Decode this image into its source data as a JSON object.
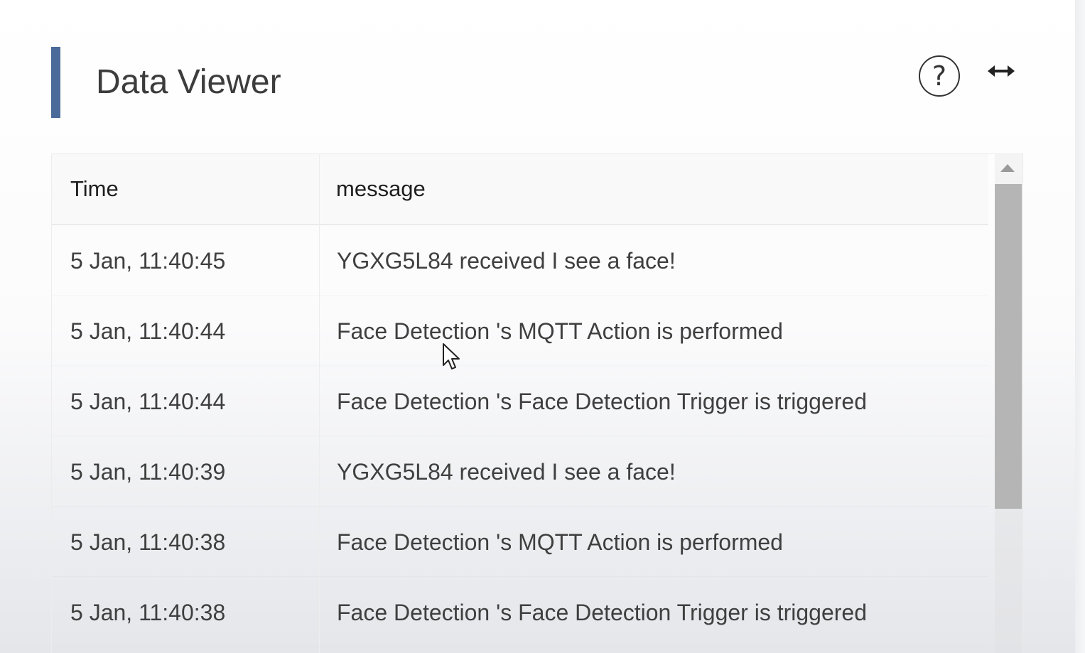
{
  "header": {
    "title": "Data Viewer",
    "help_icon": "question-circle-icon",
    "expand_icon": "horizontal-arrows-icon",
    "accent_color": "#4a6a9a"
  },
  "table": {
    "columns": [
      "Time",
      "message"
    ],
    "rows": [
      {
        "time": "5 Jan, 11:40:45",
        "message": "YGXG5L84 received I see a face!"
      },
      {
        "time": "5 Jan, 11:40:44",
        "message": "Face Detection 's MQTT Action is performed"
      },
      {
        "time": "5 Jan, 11:40:44",
        "message": "Face Detection 's Face Detection Trigger is triggered"
      },
      {
        "time": "5 Jan, 11:40:39",
        "message": "YGXG5L84 received I see a face!"
      },
      {
        "time": "5 Jan, 11:40:38",
        "message": "Face Detection 's MQTT Action is performed"
      },
      {
        "time": "5 Jan, 11:40:38",
        "message": "Face Detection 's Face Detection Trigger is triggered"
      }
    ]
  }
}
